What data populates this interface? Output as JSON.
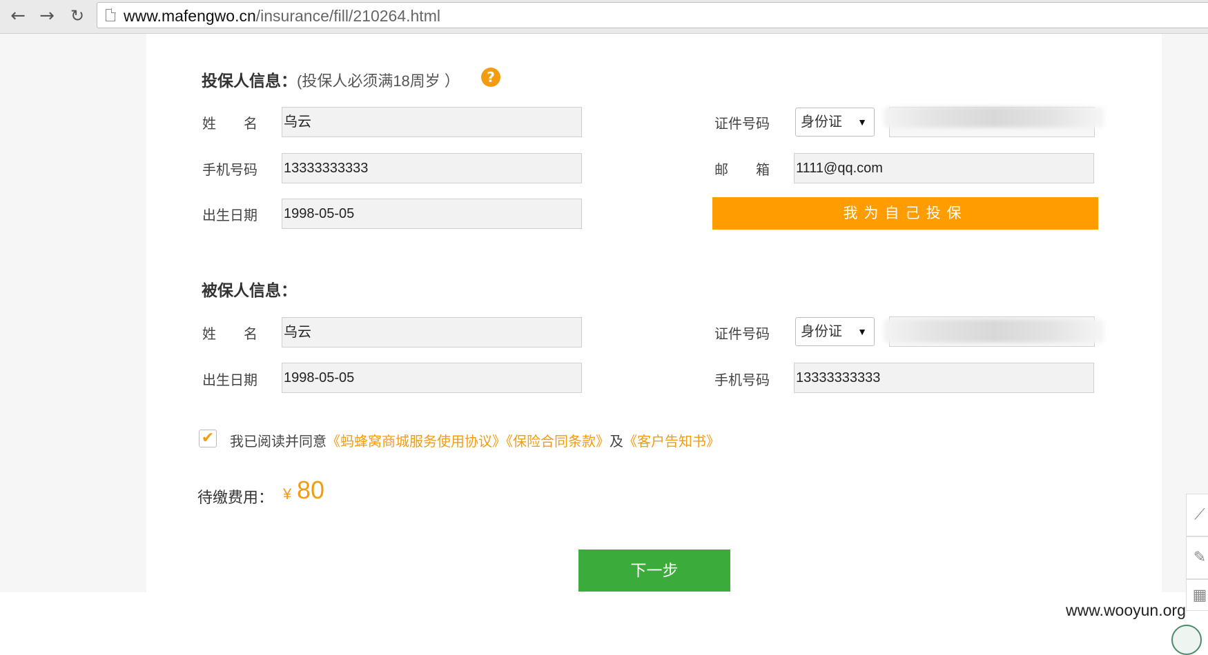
{
  "browser": {
    "url_host": "www.mafengwo.cn",
    "url_path": "/insurance/fill/210264.html"
  },
  "policyholder": {
    "title": "投保人信息：",
    "note": "(投保人必须满18周岁 ）",
    "name_label": "姓　　名",
    "name_value": "乌云",
    "phone_label": "手机号码",
    "phone_value": "13333333333",
    "birth_label": "出生日期",
    "birth_value": "1998-05-05",
    "id_label": "证件号码",
    "id_type": "身份证",
    "email_label": "邮　　箱",
    "email_value": "1111@qq.com",
    "self_button": "我为自己投保"
  },
  "insured": {
    "title": "被保人信息：",
    "name_label": "姓　　名",
    "name_value": "乌云",
    "birth_label": "出生日期",
    "birth_value": "1998-05-05",
    "id_label": "证件号码",
    "id_type": "身份证",
    "phone_label": "手机号码",
    "phone_value": "13333333333"
  },
  "agreement": {
    "prefix": "我已阅读并同意",
    "link1": "《蚂蜂窝商城服务使用协议》",
    "link2": "《保险合同条款》",
    "and": "及",
    "link3": "《客户告知书》",
    "checked": true
  },
  "fee": {
    "label": "待缴费用：",
    "currency": "¥",
    "amount": "80"
  },
  "next_button": "下一步",
  "watermark": "www.wooyun.org",
  "colors": {
    "accent": "#ff9d00",
    "link": "#f39c12",
    "next": "#3bab3b"
  }
}
